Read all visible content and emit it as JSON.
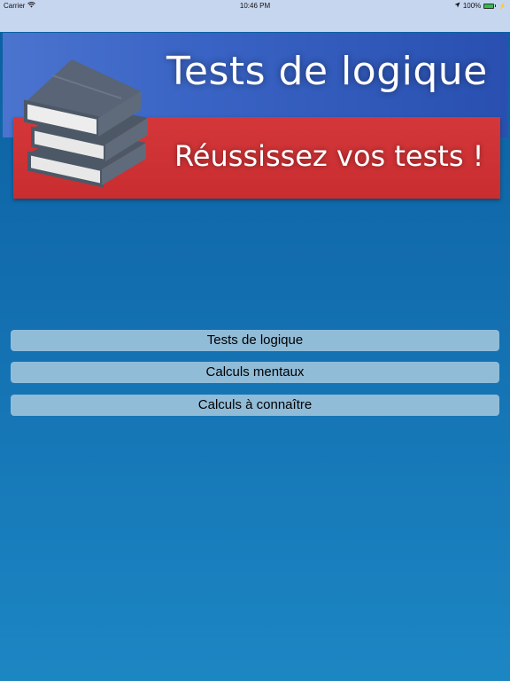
{
  "status_bar": {
    "carrier": "Carrier",
    "time": "10:46 PM",
    "battery": "100%",
    "battery_level": 1.0,
    "icons": [
      "wifi-icon",
      "location-arrow-icon",
      "battery-icon",
      "charging-bolt-icon"
    ]
  },
  "banner": {
    "title": "Tests de logique",
    "subtitle": "Réussissez vos tests !",
    "logo_icon": "books-icon"
  },
  "menu": {
    "items": [
      {
        "label": "Tests de logique"
      },
      {
        "label": "Calculs mentaux"
      },
      {
        "label": "Calculs à connaître"
      }
    ]
  },
  "colors": {
    "status_bar_bg": "#c7d6ef",
    "background_top": "#0b5fa0",
    "background_bottom": "#1c86c3",
    "banner_blue": "#3963c4",
    "banner_red": "#d4373a",
    "button_bg": "#91bcd8"
  }
}
